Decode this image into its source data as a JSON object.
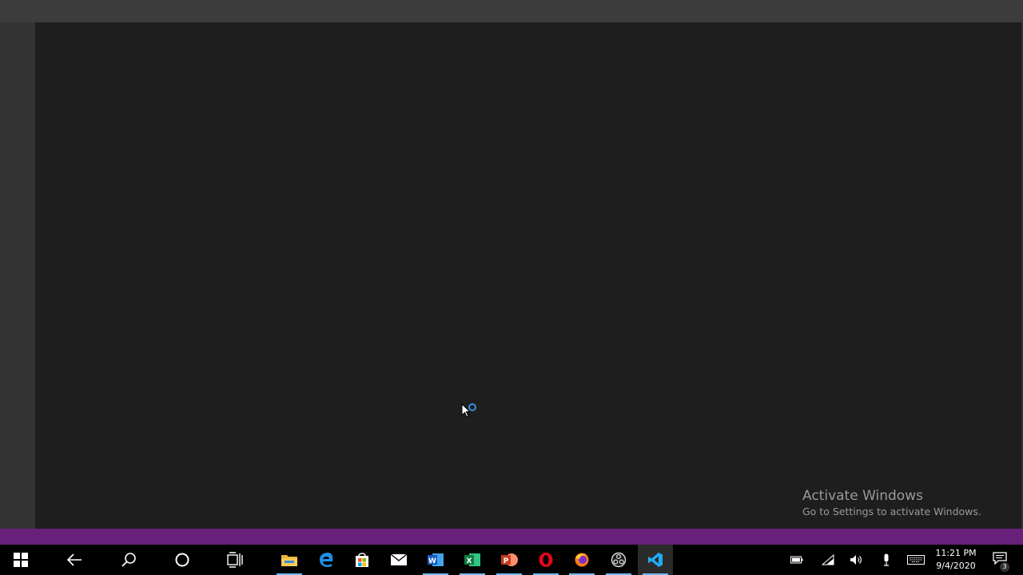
{
  "watermark": {
    "title": "Activate Windows",
    "subtitle": "Go to Settings to activate Windows."
  },
  "taskbar": {
    "apps": [
      {
        "name": "start-icon"
      },
      {
        "name": "back-arrow-icon"
      },
      {
        "name": "search-icon"
      },
      {
        "name": "cortana-icon"
      },
      {
        "name": "task-view-icon"
      },
      {
        "name": "file-explorer-icon",
        "running": true
      },
      {
        "name": "edge-icon"
      },
      {
        "name": "store-icon"
      },
      {
        "name": "mail-icon"
      },
      {
        "name": "word-icon",
        "running": true
      },
      {
        "name": "excel-icon",
        "running": true
      },
      {
        "name": "powerpoint-icon",
        "running": true
      },
      {
        "name": "opera-icon",
        "running": true
      },
      {
        "name": "firefox-icon",
        "running": true
      },
      {
        "name": "obs-icon",
        "running": true
      },
      {
        "name": "vscode-icon",
        "running": true,
        "active": true
      }
    ],
    "tray": {
      "time": "11:21 PM",
      "date": "9/4/2020",
      "notification_count": "3"
    }
  },
  "colors": {
    "titlebar": "#3c3c3c",
    "activitybar": "#333333",
    "editor": "#1e1e1e",
    "statusbar": "#68217a",
    "taskbar": "#000000",
    "accent": "#76b9ed"
  }
}
